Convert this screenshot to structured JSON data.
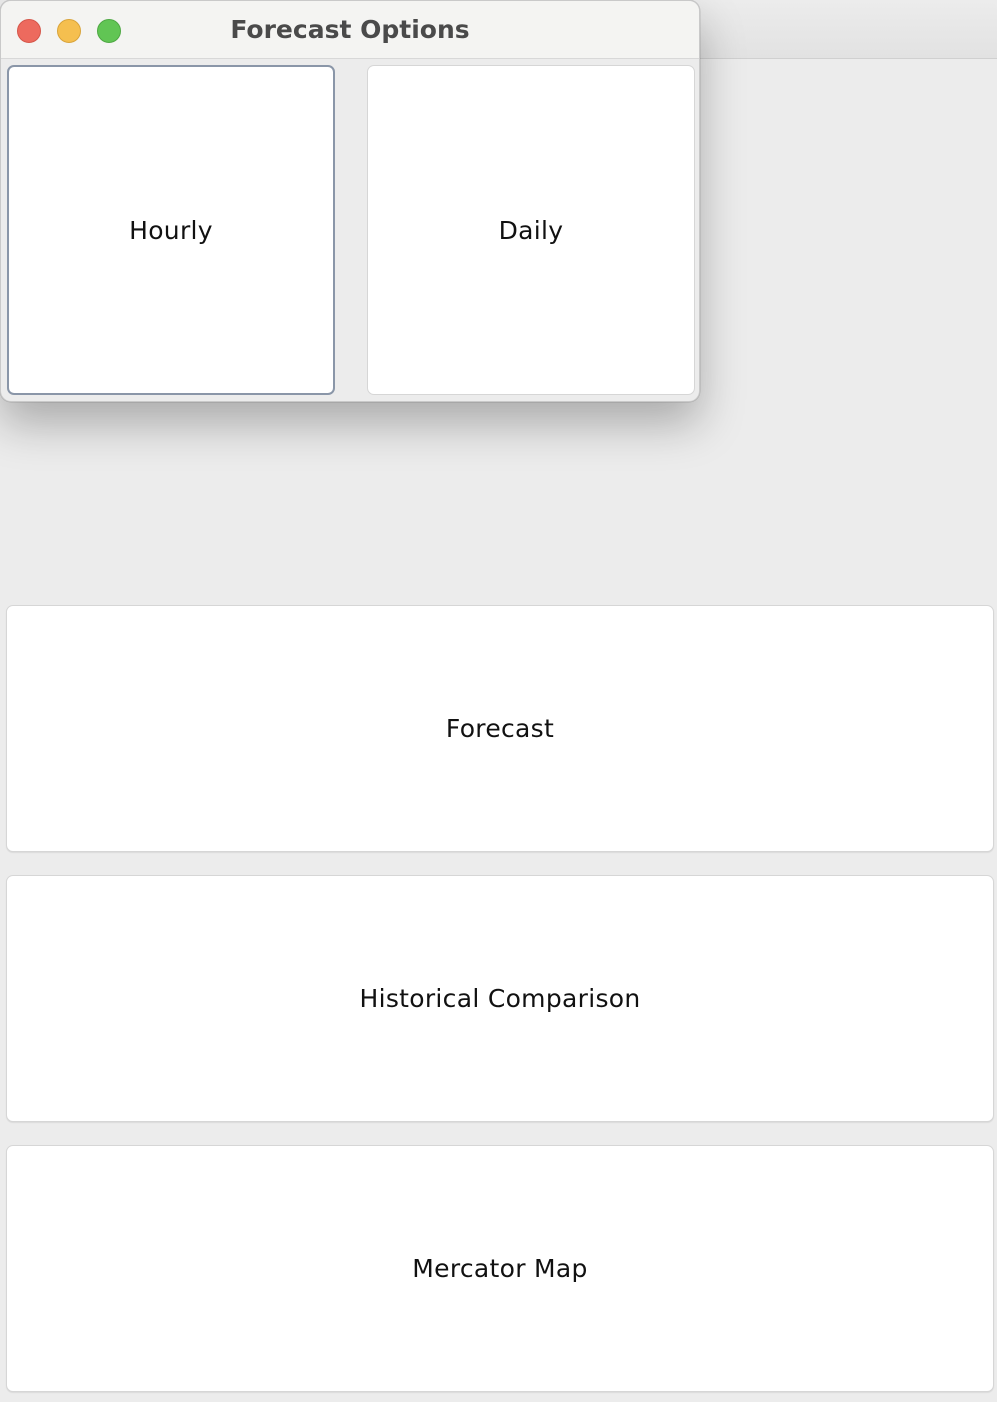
{
  "main_window": {
    "buttons": {
      "forecast": "Forecast",
      "historical": "Historical Comparison",
      "mercator": "Mercator Map"
    }
  },
  "dialog": {
    "title": "Forecast Options",
    "buttons": {
      "hourly": "Hourly",
      "daily": "Daily"
    },
    "focused_button": "hourly"
  },
  "colors": {
    "close": "#ed6a5e",
    "minimize": "#f5bf4f",
    "maximize": "#61c554",
    "focus_ring": "#8a96a8"
  }
}
